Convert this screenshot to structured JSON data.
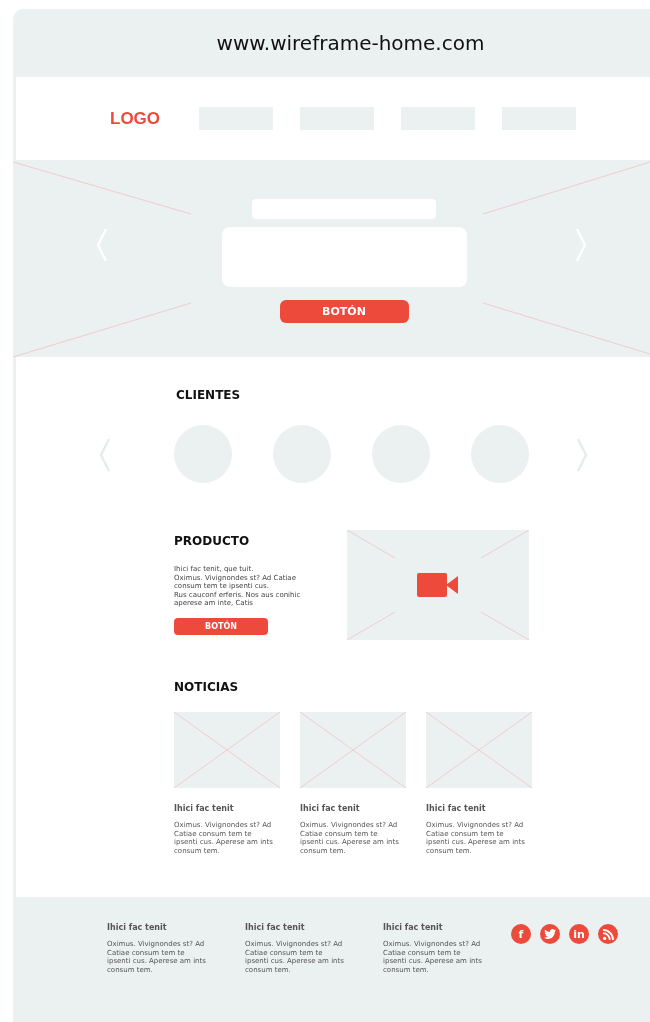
{
  "browser": {
    "url": "www.wireframe-home.com"
  },
  "header": {
    "logo": "LOGO",
    "nav_items": [
      {
        "kind": "placeholder"
      },
      {
        "kind": "placeholder"
      },
      {
        "kind": "placeholder"
      },
      {
        "kind": "placeholder"
      }
    ]
  },
  "hero": {
    "button": "BOTÓN"
  },
  "clients": {
    "heading": "CLIENTES",
    "items": [
      {
        "kind": "placeholder"
      },
      {
        "kind": "placeholder"
      },
      {
        "kind": "placeholder"
      },
      {
        "kind": "placeholder"
      }
    ]
  },
  "product": {
    "heading": "PRODUCTO",
    "text": [
      "Ihici fac tenit, que tuit.",
      "Oximus. Vivignondes st? Ad Catiae consum tem te ipsenti cus.",
      "Rus cauconf erferis. Nos aus conihic aperese am inte, Catis"
    ],
    "button": "BOTÓN"
  },
  "news": {
    "heading": "NOTICIAS",
    "items": [
      {
        "title": "Ihici fac tenit",
        "text": "Oximus. Vivignondes st? Ad Catiae consum tem te ipsenti cus. Aperese am ints consum tem."
      },
      {
        "title": "Ihici fac tenit",
        "text": "Oximus. Vivignondes st? Ad Catiae consum tem te ipsenti cus. Aperese am ints consum tem."
      },
      {
        "title": "Ihici fac tenit",
        "text": "Oximus. Vivignondes st? Ad Catiae consum tem te ipsenti cus. Aperese am ints consum tem."
      }
    ]
  },
  "footer": {
    "columns": [
      {
        "title": "Ihici fac tenit",
        "text": "Oximus. Vivignondes st? Ad Catiae consum tem te ipsenti cus. Aperese am ints consum tem."
      },
      {
        "title": "Ihici fac tenit",
        "text": "Oximus. Vivignondes st? Ad Catiae consum tem te ipsenti cus. Aperese am ints consum tem."
      },
      {
        "title": "Ihici fac tenit",
        "text": "Oximus. Vivignondes st? Ad Catiae consum tem te ipsenti cus. Aperese am ints consum tem."
      }
    ],
    "social": [
      {
        "kind": "letter",
        "label": "f"
      },
      {
        "kind": "bird"
      },
      {
        "kind": "letter",
        "label": "in"
      },
      {
        "kind": "feed"
      }
    ]
  }
}
